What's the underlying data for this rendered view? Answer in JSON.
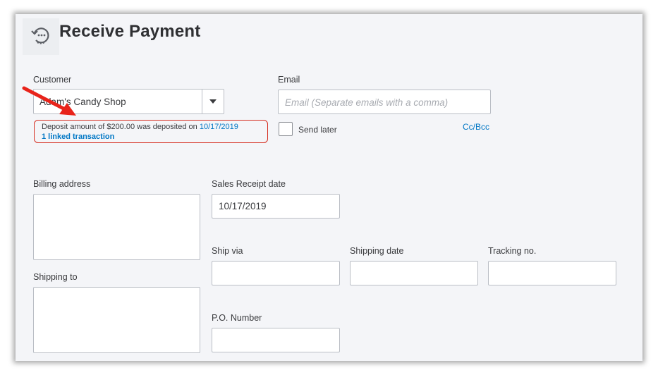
{
  "header": {
    "title": "Receive Payment",
    "icon": "clock-refresh-icon"
  },
  "customer": {
    "label": "Customer",
    "value": "Adam's Candy Shop"
  },
  "email": {
    "label": "Email",
    "placeholder": "Email (Separate emails with a comma)"
  },
  "send_later": {
    "label": "Send later",
    "checked": false
  },
  "cc_bcc": {
    "label": "Cc/Bcc"
  },
  "deposit_notice": {
    "text": "Deposit amount of $200.00 was deposited on ",
    "date_link": "10/17/2019",
    "linked_link": "1 linked transaction"
  },
  "billing_address": {
    "label": "Billing address",
    "value": ""
  },
  "shipping_to": {
    "label": "Shipping to",
    "value": ""
  },
  "sales_receipt_date": {
    "label": "Sales Receipt date",
    "value": "10/17/2019"
  },
  "ship_via": {
    "label": "Ship via",
    "value": ""
  },
  "shipping_date": {
    "label": "Shipping date",
    "value": ""
  },
  "tracking_no": {
    "label": "Tracking no.",
    "value": ""
  },
  "po_number": {
    "label": "P.O. Number",
    "value": ""
  },
  "colors": {
    "accent_link": "#0077c5",
    "alert_red": "#d52b1e",
    "arrow_red": "#e8231a"
  }
}
